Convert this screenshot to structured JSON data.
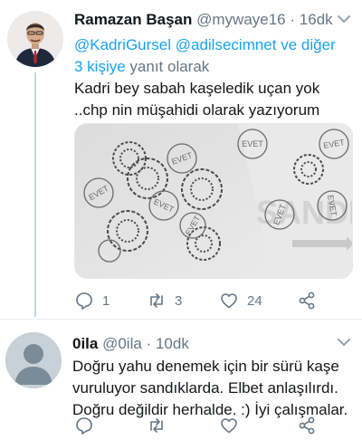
{
  "tweets": [
    {
      "author_name": "Ramazan Başan",
      "handle": "@mywaye16",
      "separator": "·",
      "time": "16dk",
      "reply_mentions": "@KadriGursel @adilsecimnet ve diğer 3 kişiye",
      "reply_suffix": "yanıt olarak",
      "text": "Kadri bey sabah kaşeledik uçan yok ..chp nin müşahidi olarak yazıyorum",
      "photo_stamp_text": "EVET",
      "photo_bg_text": "SANDIK",
      "counts": {
        "replies": "1",
        "retweets": "3",
        "likes": "24"
      }
    },
    {
      "author_name": "0ila",
      "handle": "@0ila",
      "separator": "·",
      "time": "10dk",
      "text": "Doğru yahu denemek için bir sürü kaşe vuruluyor sandıklarda. Elbet anlaşılırdı. Doğru değildir herhalde. :) İyi çalışmalar.",
      "counts": {
        "replies": "",
        "retweets": "",
        "likes": ""
      }
    }
  ],
  "icons": {
    "reply": "reply-icon",
    "retweet": "retweet-icon",
    "like": "heart-icon",
    "share": "share-icon",
    "caret": "chevron-down-icon"
  },
  "colors": {
    "link": "#1da1f2",
    "meta": "#657786",
    "text": "#14171a"
  }
}
